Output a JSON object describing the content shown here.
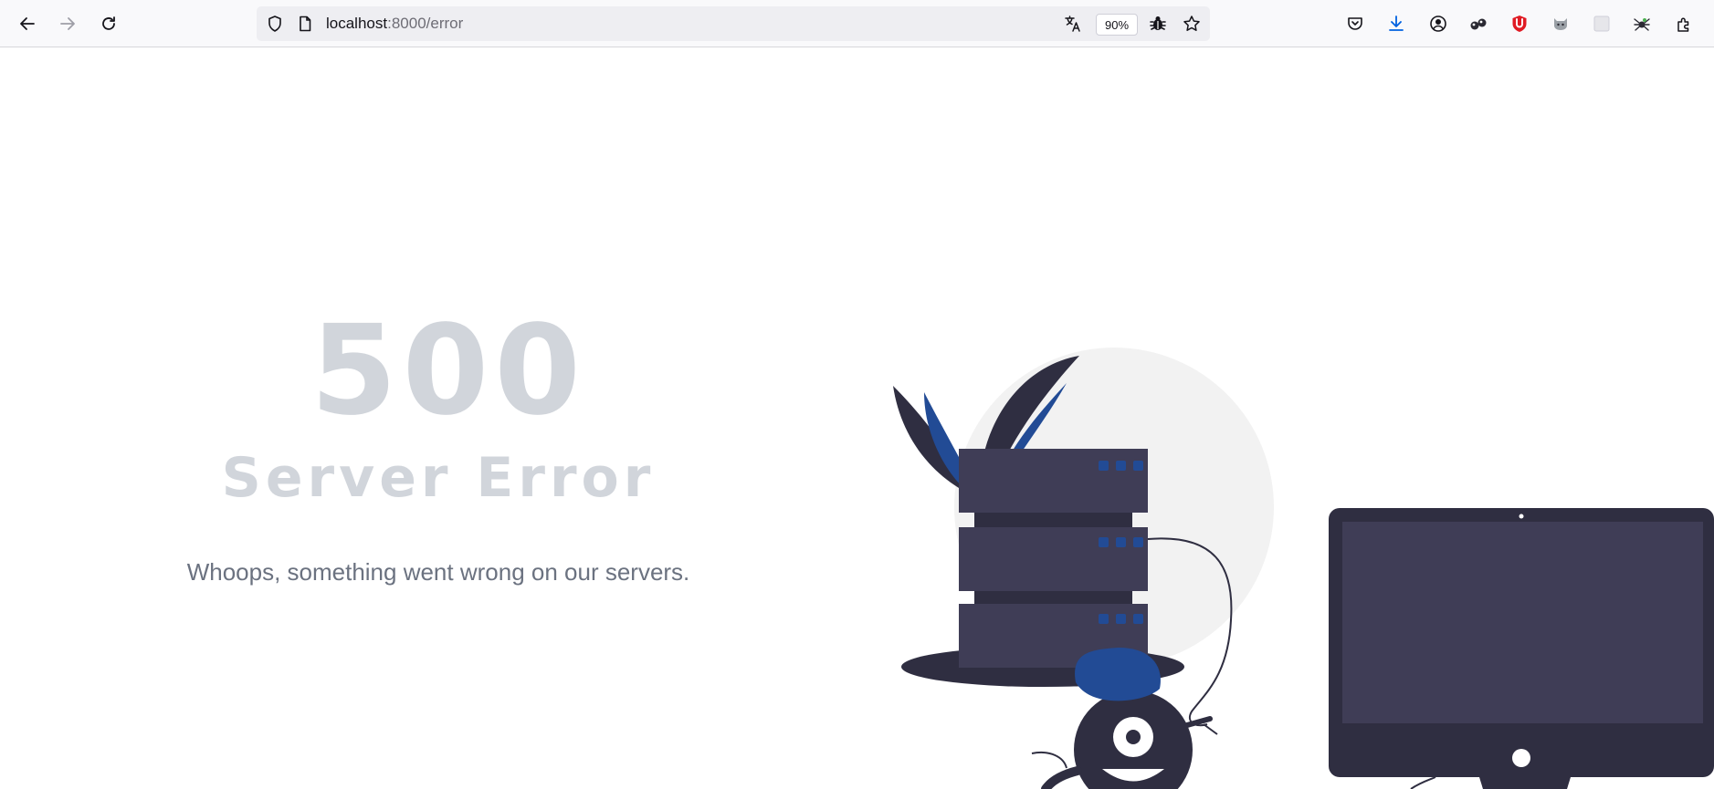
{
  "browser": {
    "url_host": "localhost",
    "url_path": ":8000/error",
    "zoom": "90%"
  },
  "page": {
    "code": "500",
    "title": "Server Error",
    "message": "Whoops, something went wrong on our servers."
  },
  "colors": {
    "muted_text": "#d1d5db",
    "body_text": "#6b7280",
    "illustration_dark": "#2f2e41",
    "illustration_mid": "#3f3d56",
    "illustration_accent": "#224b95",
    "illustration_light": "#f2f2f2"
  },
  "icons": {
    "back": "back-arrow-icon",
    "forward": "forward-arrow-icon",
    "reload": "reload-icon",
    "tracking": "shield-icon",
    "page": "page-icon",
    "translate": "translate-icon",
    "bug": "bug-icon",
    "bookmark": "star-icon",
    "pocket": "pocket-icon",
    "downloads": "download-icon",
    "account": "account-icon",
    "extensions": [
      "glasses-extension-icon",
      "ublock-extension-icon",
      "cat-extension-icon",
      "blank-extension-icon",
      "spider-extension-icon",
      "puzzle-icon"
    ]
  }
}
